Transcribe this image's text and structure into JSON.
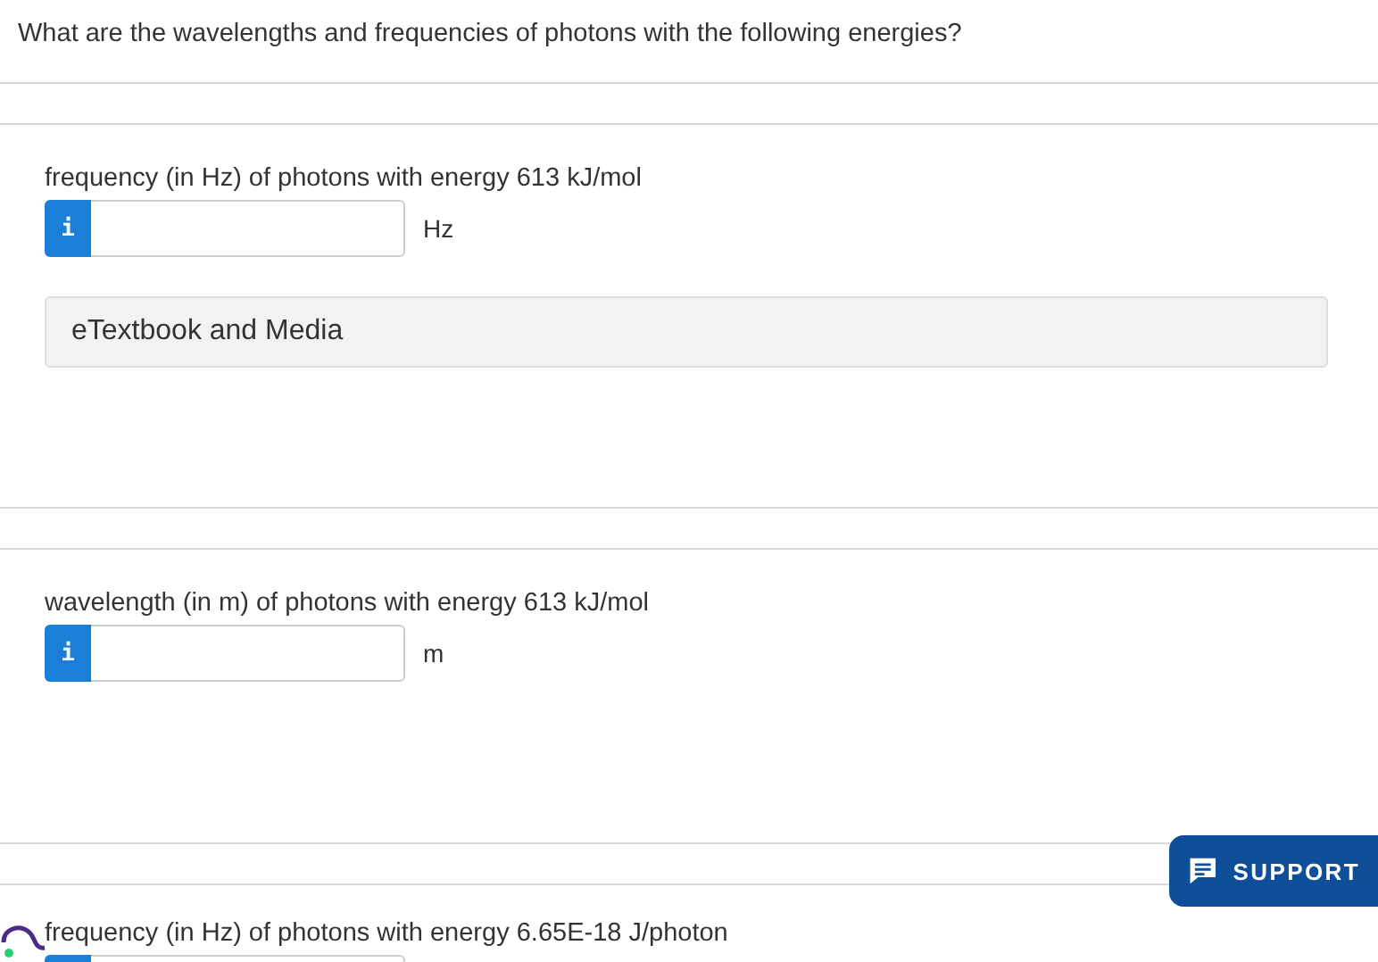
{
  "question": "What are the wavelengths and frequencies of photons with the following energies?",
  "parts": [
    {
      "label": "frequency (in Hz) of photons with energy 613 kJ/mol",
      "info": "i",
      "unit": "Hz",
      "resource": "eTextbook and Media"
    },
    {
      "label": "wavelength (in m) of photons with energy 613 kJ/mol",
      "info": "i",
      "unit": "m"
    },
    {
      "label": "frequency (in Hz) of photons with energy 6.65E-18 J/photon"
    }
  ],
  "support": "SUPPORT"
}
